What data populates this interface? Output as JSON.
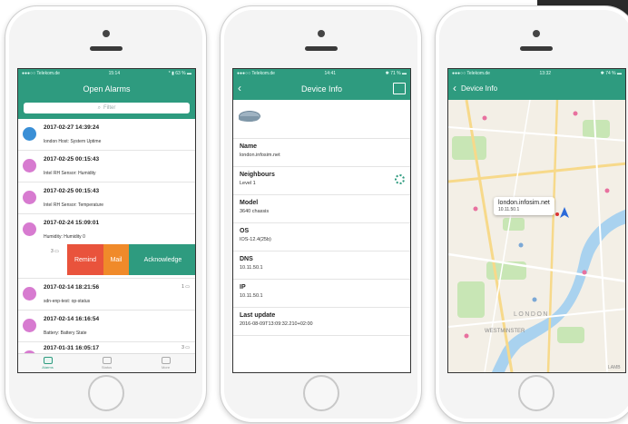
{
  "colors": {
    "accent": "#2e9b7f",
    "alarm_blue": "#3a8fd6",
    "alarm_pink": "#d77bd0",
    "remind": "#e9533c",
    "mail": "#f08a2a",
    "ack": "#2e9b7f",
    "water": "#a9d2ef",
    "park": "#c8e6b5"
  },
  "screen1": {
    "status": {
      "carrier": "●●●○○ Telekom.de",
      "time": "15:14",
      "battery": "* ▮ 63 % ▬"
    },
    "title": "Open Alarms",
    "filter_placeholder": "Filter",
    "alarms": [
      {
        "date": "2017-02-27 14:39:24",
        "desc": "london Host: System Uptime",
        "color": "#3a8fd6"
      },
      {
        "date": "2017-02-25 00:15:43",
        "desc": "Intel RH Sensor: Humidity",
        "color": "#d77bd0"
      },
      {
        "date": "2017-02-25 00:15:43",
        "desc": "Intel RH Sensor: Temperature",
        "color": "#d77bd0"
      },
      {
        "date": "2017-02-24 15:09:01",
        "desc": "Humidity: Humidity 0",
        "color": "#d77bd0",
        "count": "3"
      },
      {
        "date": "2017-02-14 18:21:56",
        "desc": "sdn-enp-test: op-status",
        "color": "#d77bd0",
        "count": "1"
      },
      {
        "date": "2017-02-14 16:16:54",
        "desc": "Battery: Battery State",
        "color": "#d77bd0"
      },
      {
        "date": "2017-01-31 16:05:17",
        "desc": "",
        "color": "#d77bd0",
        "count": "3"
      }
    ],
    "actions": {
      "remind": "Remind",
      "mail": "Mail",
      "acknowledge": "Acknowledge"
    },
    "tabs": [
      {
        "label": "Alarms"
      },
      {
        "label": "Status"
      },
      {
        "label": "More"
      }
    ]
  },
  "screen2": {
    "status": {
      "carrier": "●●●○○ Telekom.de",
      "time": "14:41",
      "battery": "✱ 71 % ▬"
    },
    "title": "Device Info",
    "fields": [
      {
        "label": "Name",
        "value": "london.infosim.net"
      },
      {
        "label": "Neighbours",
        "value": "Level 1"
      },
      {
        "label": "Model",
        "value": "3640 chassis"
      },
      {
        "label": "OS",
        "value": "IOS-12.4(25b)"
      },
      {
        "label": "DNS",
        "value": "10.11.50.1"
      },
      {
        "label": "IP",
        "value": "10.11.50.1"
      },
      {
        "label": "Last update",
        "value": "2016-08-09T13:09:32.210+02:00"
      }
    ]
  },
  "screen3": {
    "status": {
      "carrier": "●●●○○ Telekom.de",
      "time": "13:32",
      "battery": "✱ 74 % ▬"
    },
    "back_label": "Device Info",
    "callout_title": "london.infosim.net",
    "callout_subtitle": "10.11.50.1",
    "map_labels": [
      "WESTMINSTER",
      "LONDON",
      "LAMB"
    ]
  }
}
